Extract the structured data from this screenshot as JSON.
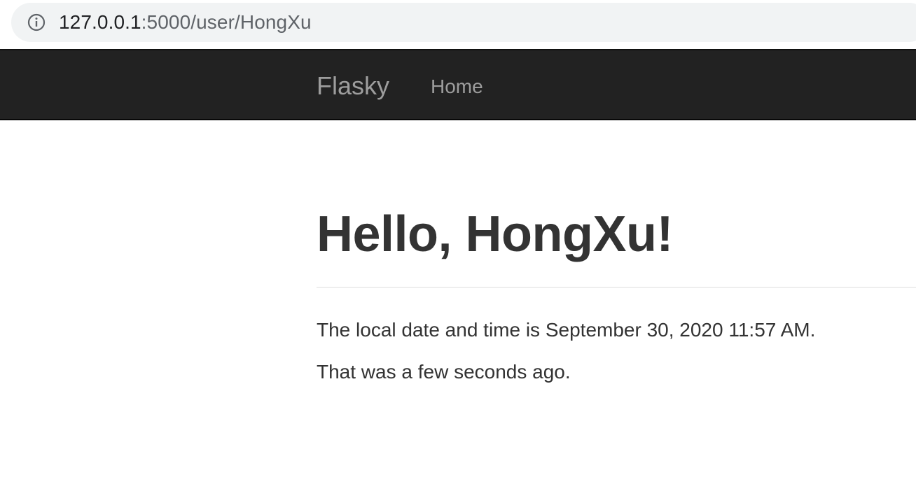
{
  "browser": {
    "url_host": "127.0.0.1",
    "url_rest": ":5000/user/HongXu",
    "info_icon": "info-icon"
  },
  "navbar": {
    "brand": "Flasky",
    "items": [
      {
        "label": "Home"
      }
    ]
  },
  "main": {
    "title": "Hello, HongXu!",
    "local_time_line": "The local date and time is September 30, 2020 11:57 AM.",
    "relative_time_line": "That was a few seconds ago."
  },
  "colors": {
    "navbar_bg": "#222222",
    "nav_text": "#9d9d9d",
    "body_text": "#333333",
    "urlbar_bg": "#f1f3f4"
  }
}
